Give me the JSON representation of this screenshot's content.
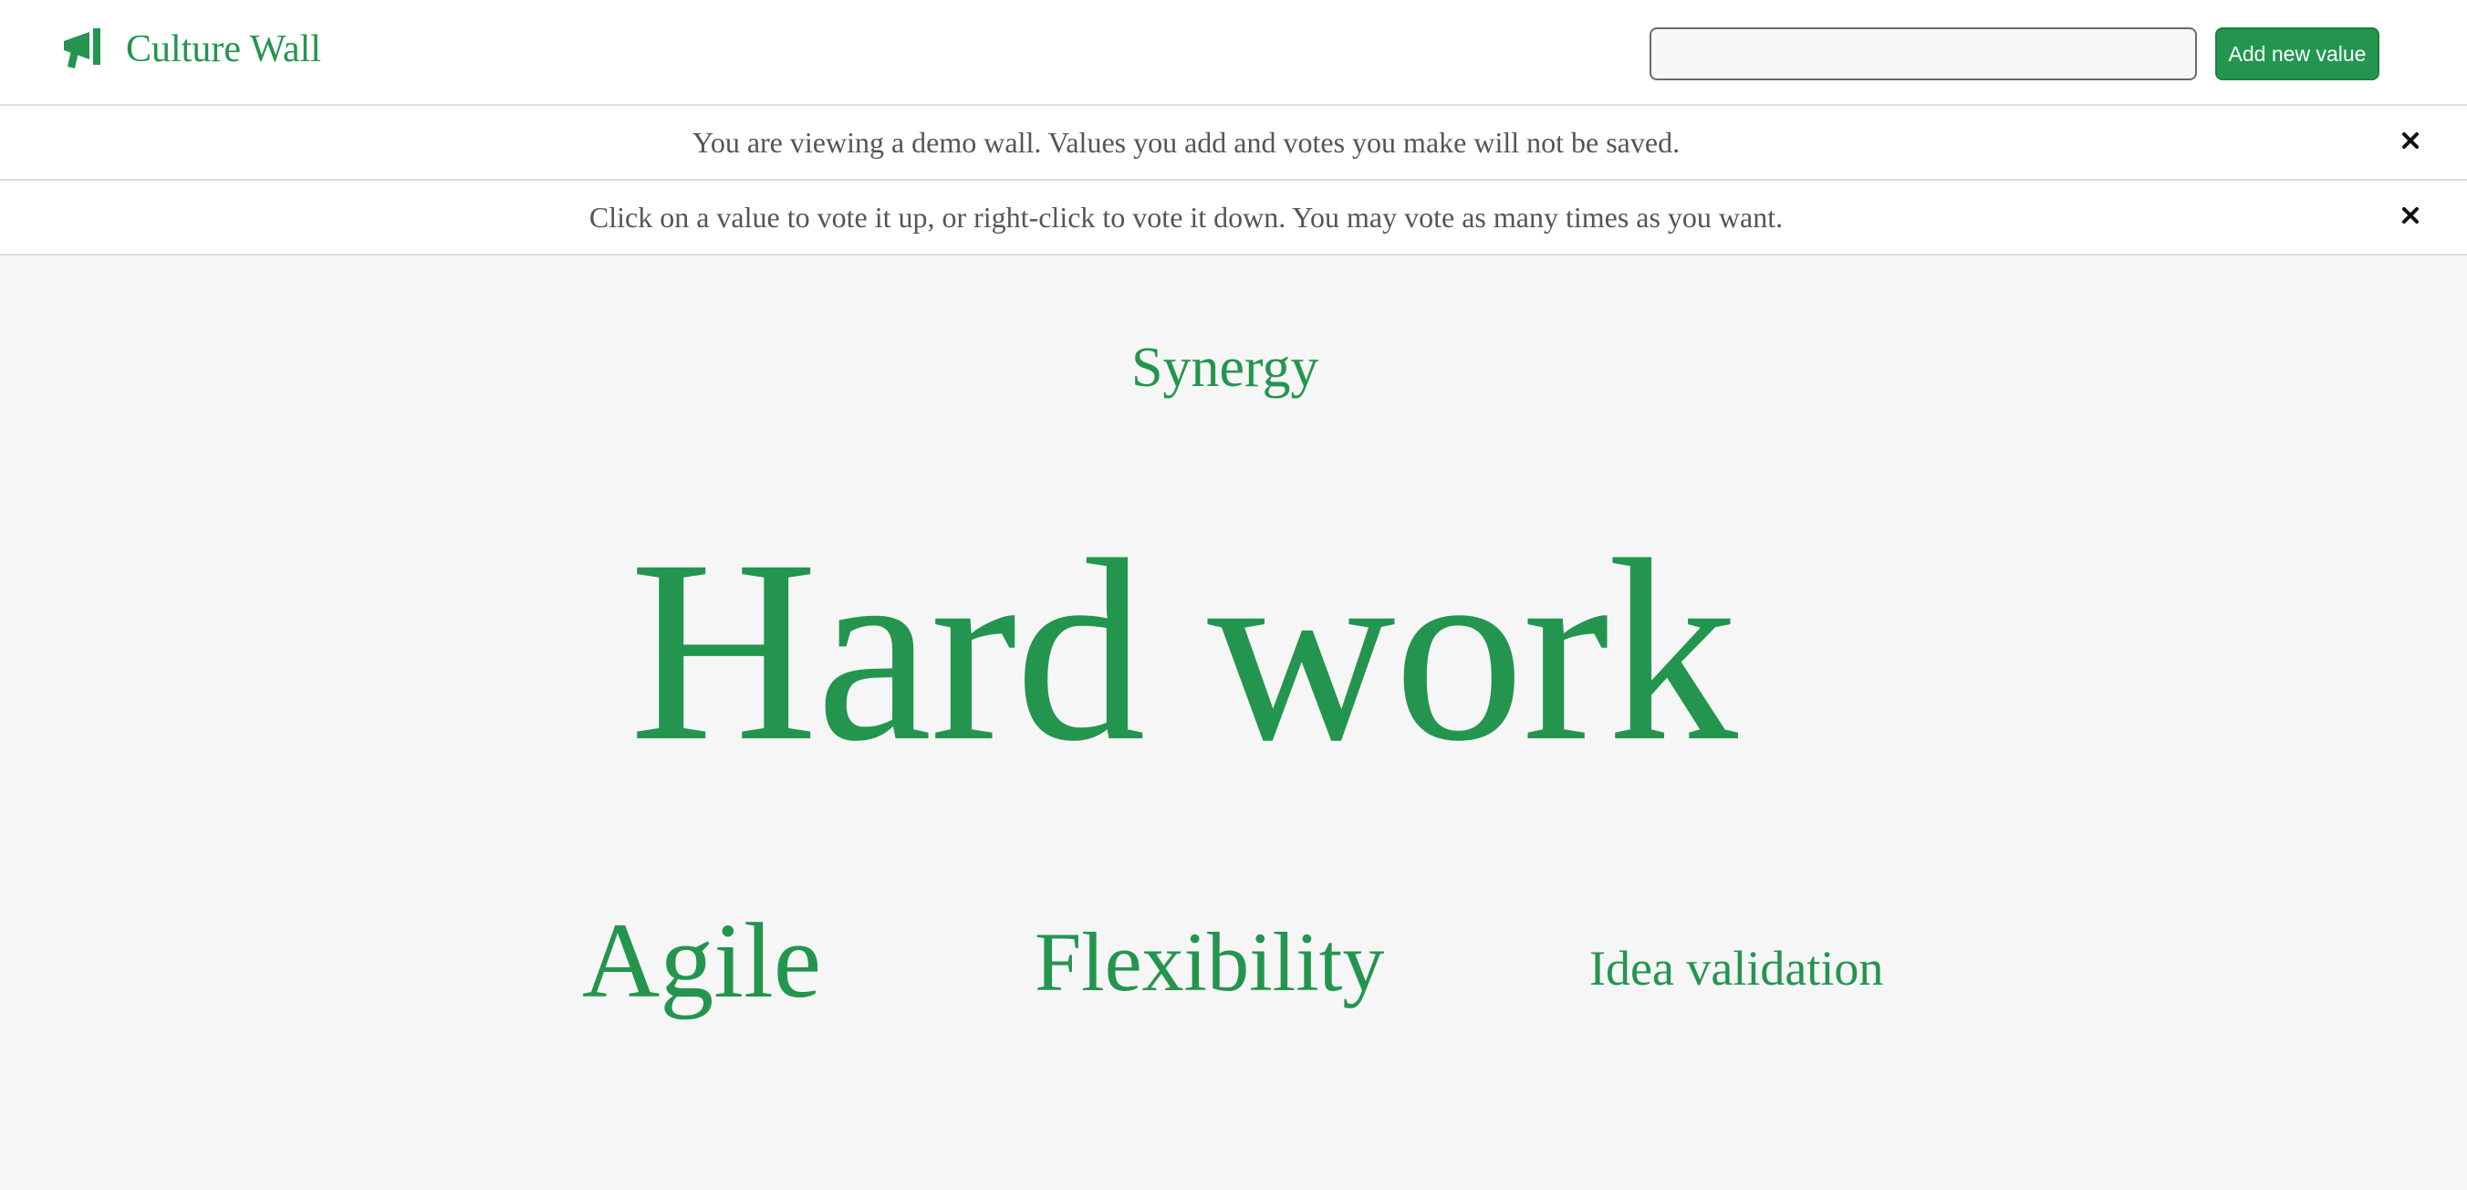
{
  "app": {
    "title": "Culture Wall",
    "icon": "megaphone-icon",
    "accent_color": "#23954f"
  },
  "header": {
    "search": {
      "value": "",
      "placeholder": ""
    },
    "add_button_label": "Add new value"
  },
  "banners": [
    {
      "text": "You are viewing a demo wall. Values you add and votes you make will not be saved.",
      "close_icon": "close-icon"
    },
    {
      "text": "Click on a value to vote it up, or right-click to vote it down. You may vote as many times as you want.",
      "close_icon": "close-icon"
    }
  ],
  "wall": {
    "values": [
      {
        "label": "Synergy"
      },
      {
        "label": "Hard work"
      },
      {
        "label": "Agile"
      },
      {
        "label": "Flexibility"
      },
      {
        "label": "Idea validation"
      }
    ]
  }
}
